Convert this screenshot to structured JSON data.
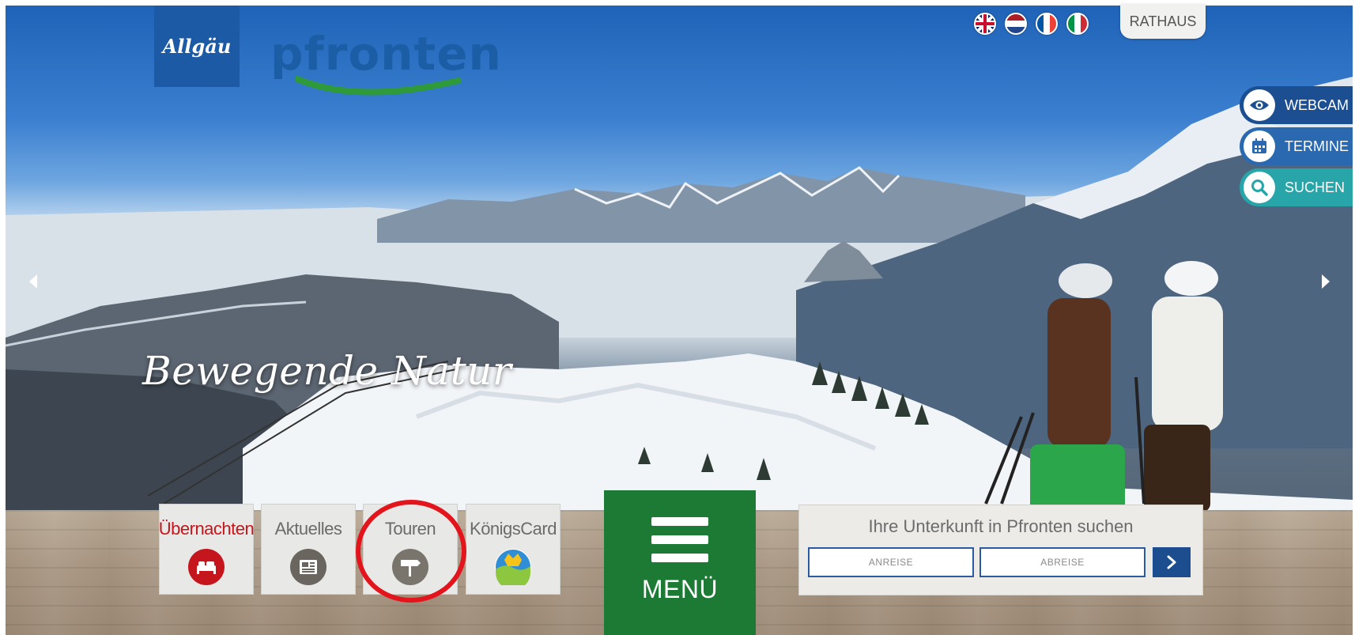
{
  "header": {
    "allgaeu_logo_text": "Allgäu",
    "pfronten_logo_text": "pfronten",
    "rathaus_label": "RATHAUS",
    "languages": [
      {
        "code": "uk",
        "icon": "uk-flag-icon"
      },
      {
        "code": "nl",
        "icon": "nl-flag-icon"
      },
      {
        "code": "fr",
        "icon": "fr-flag-icon"
      },
      {
        "code": "it",
        "icon": "it-flag-icon"
      }
    ]
  },
  "side_links": {
    "webcam": {
      "label": "WEBCAM",
      "icon": "eye-icon",
      "color": "#1b4f92"
    },
    "termine": {
      "label": "TERMINE",
      "icon": "calendar-icon",
      "color": "#2a69b0"
    },
    "suchen": {
      "label": "SUCHEN",
      "icon": "search-icon",
      "color": "#27a5a8"
    }
  },
  "hero": {
    "tagline": "Bewegende Natur"
  },
  "tiles": {
    "uebernachten": {
      "label": "Übernachten",
      "icon": "bed-icon",
      "color": "#c4161c"
    },
    "aktuelles": {
      "label": "Aktuelles",
      "icon": "newspaper-icon",
      "color": "#6a655e"
    },
    "touren": {
      "label": "Touren",
      "icon": "signpost-icon",
      "color": "#79756d"
    },
    "koenigscard": {
      "label": "KönigsCard",
      "icon": "koenigscard-icon"
    }
  },
  "menu": {
    "label": "MENÜ",
    "icon": "hamburger-icon",
    "color": "#1c7a34"
  },
  "accommodation_search": {
    "title": "Ihre Unterkunft in Pfronten suchen",
    "anreise_placeholder": "ANREISE",
    "abreise_placeholder": "ABREISE",
    "submit_icon": "chevron-right-icon"
  },
  "highlight": {
    "color": "#e3141b"
  }
}
